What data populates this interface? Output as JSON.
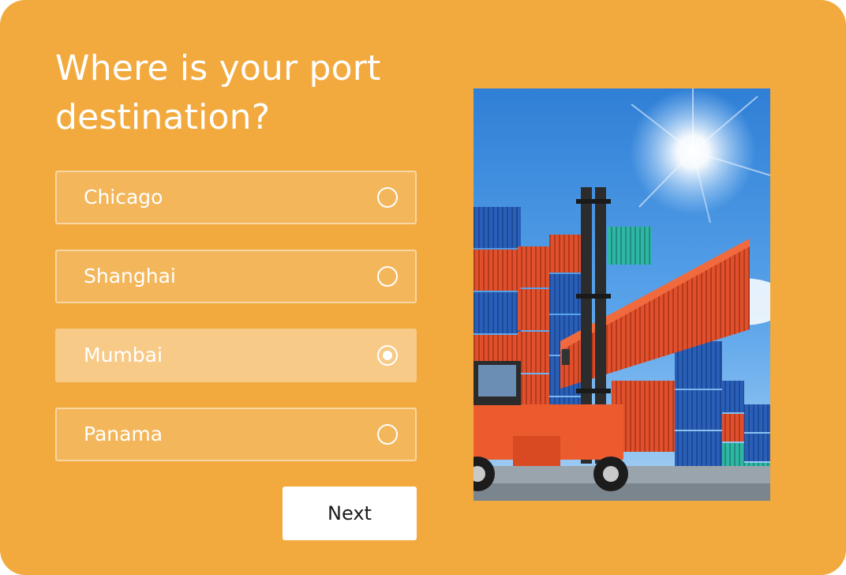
{
  "survey": {
    "question": "Where is your port destination?",
    "options": [
      {
        "label": "Chicago",
        "selected": false
      },
      {
        "label": "Shanghai",
        "selected": false
      },
      {
        "label": "Mumbai",
        "selected": true
      },
      {
        "label": "Panama",
        "selected": false
      }
    ],
    "next_label": "Next"
  },
  "colors": {
    "background": "#f2aa3f",
    "button_bg": "#ffffff"
  },
  "image": {
    "subject": "container-port-photo"
  }
}
